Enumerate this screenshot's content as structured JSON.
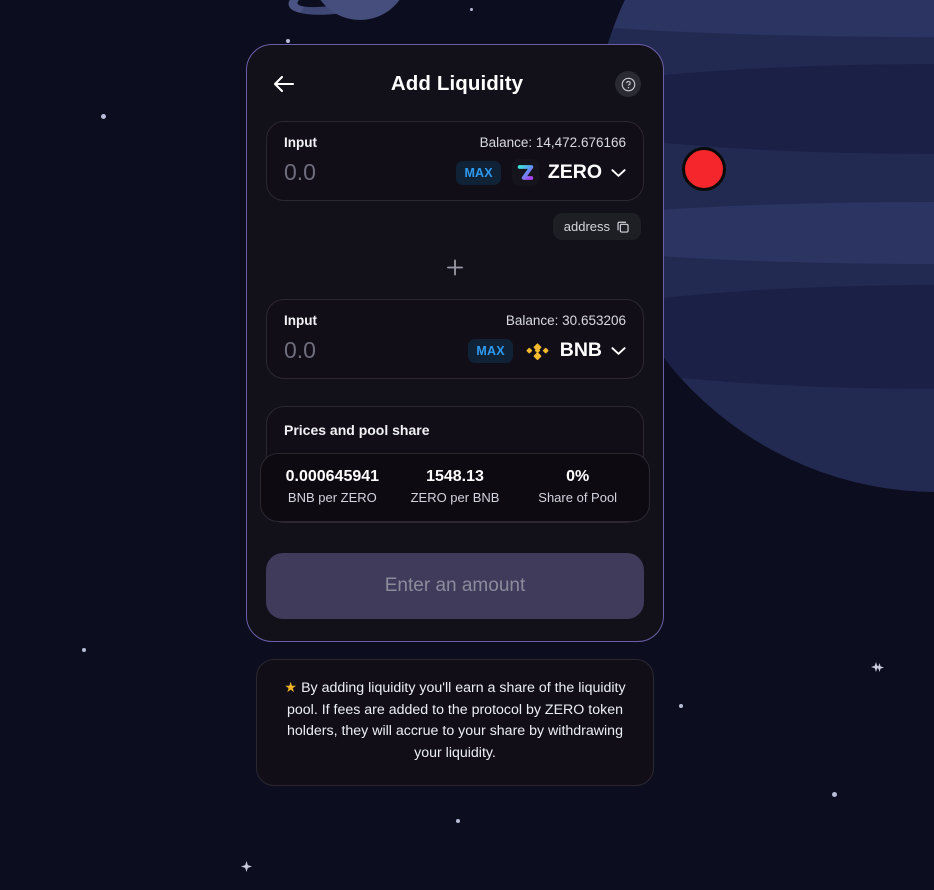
{
  "header": {
    "title": "Add Liquidity",
    "back_icon": "arrow-left-icon",
    "help_icon": "question-mark-circle-icon"
  },
  "input_a": {
    "label": "Input",
    "balance": "Balance: 14,472.676166",
    "amount_value": "",
    "amount_placeholder": "0.0",
    "max_label": "MAX",
    "token_symbol": "ZERO",
    "token_logo": "zero-token-icon",
    "chevron": "chevron-down-icon"
  },
  "address_chip": {
    "label": "address",
    "icon": "copy-icon"
  },
  "separator": {
    "icon": "plus-icon"
  },
  "input_b": {
    "label": "Input",
    "balance": "Balance: 30.653206",
    "amount_value": "",
    "amount_placeholder": "0.0",
    "max_label": "MAX",
    "token_symbol": "BNB",
    "token_logo": "bnb-token-icon",
    "chevron": "chevron-down-icon"
  },
  "prices": {
    "title": "Prices and pool share",
    "cells": [
      {
        "value": "0.000645941",
        "label": "BNB per ZERO"
      },
      {
        "value": "1548.13",
        "label": "ZERO per BNB"
      },
      {
        "value": "0%",
        "label": "Share of Pool"
      }
    ]
  },
  "submit": {
    "label": "Enter an amount"
  },
  "footer": {
    "star": "★",
    "text": "By adding liquidity you'll earn a share of the liquidity pool. If fees are added to the protocol by ZERO token holders, they will accrue to your share by withdrawing your liquidity."
  },
  "colors": {
    "card_border": "#6a5ea6",
    "card_bg": "#121018",
    "page_bg": "#0c0e20",
    "max_text": "#2e9bf0",
    "submit_bg": "#403b5b",
    "bnb_gold": "#f3ba2f",
    "cursor_red": "#f5262c",
    "star_gold": "#f0b429"
  }
}
